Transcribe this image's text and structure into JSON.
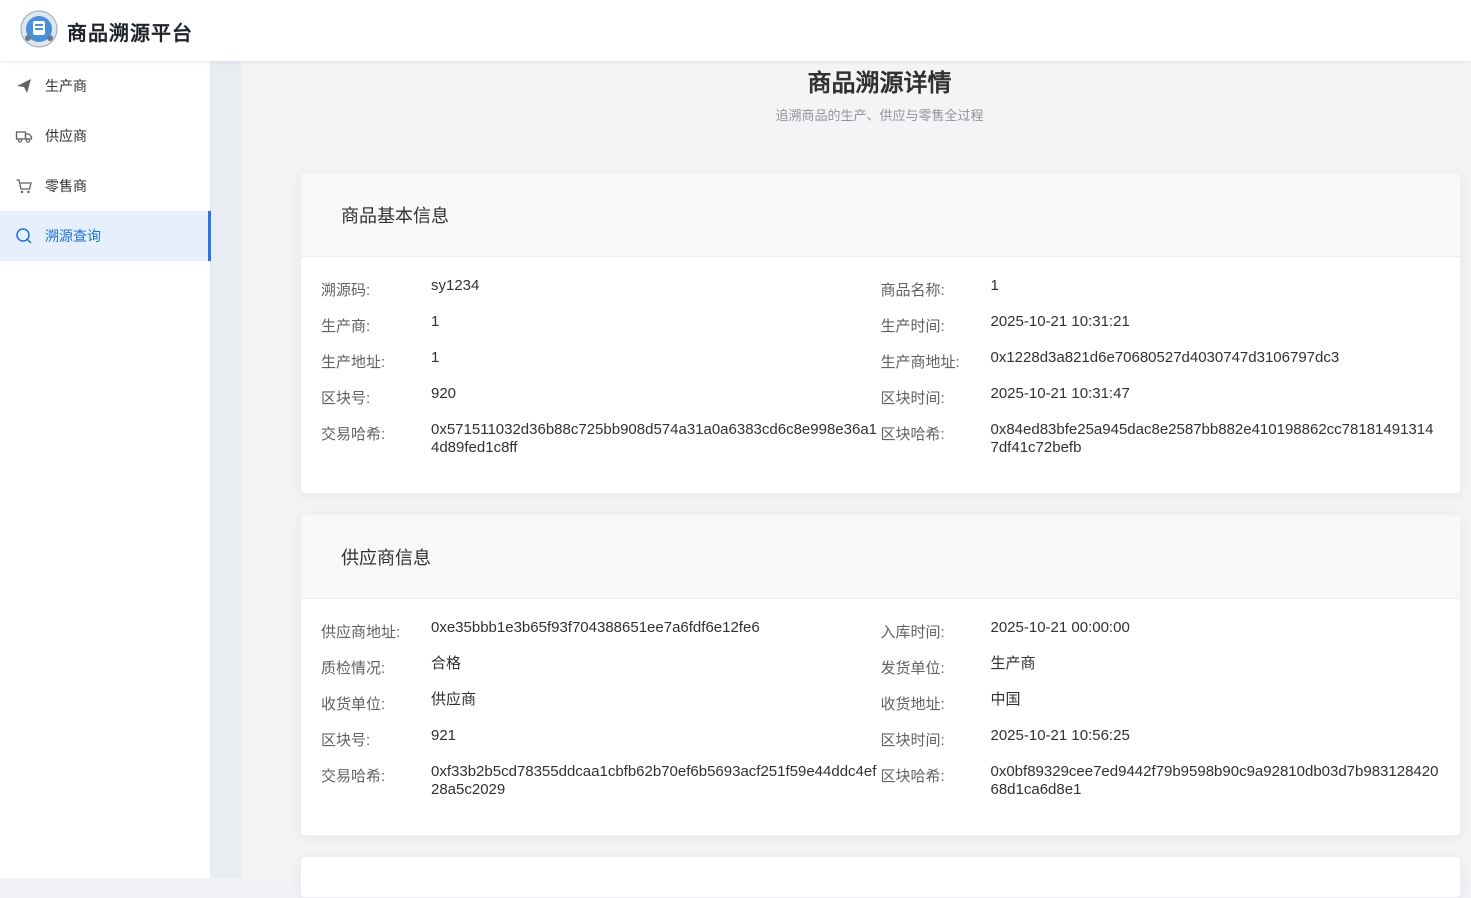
{
  "app": {
    "title": "商品溯源平台"
  },
  "sidebar": {
    "items": [
      {
        "label": "生产商",
        "icon": "paper-plane-icon"
      },
      {
        "label": "供应商",
        "icon": "truck-icon"
      },
      {
        "label": "零售商",
        "icon": "cart-icon"
      },
      {
        "label": "溯源查询",
        "icon": "search-icon"
      }
    ]
  },
  "page": {
    "title": "商品溯源详情",
    "subtitle": "追溯商品的生产、供应与零售全过程"
  },
  "basic_info": {
    "heading": "商品基本信息",
    "rows": [
      [
        {
          "label": "溯源码:",
          "value": "sy1234"
        },
        {
          "label": "商品名称:",
          "value": "1"
        }
      ],
      [
        {
          "label": "生产商:",
          "value": "1"
        },
        {
          "label": "生产时间:",
          "value": "2025-10-21 10:31:21"
        }
      ],
      [
        {
          "label": "生产地址:",
          "value": "1"
        },
        {
          "label": "生产商地址:",
          "value": "0x1228d3a821d6e70680527d4030747d3106797dc3"
        }
      ],
      [
        {
          "label": "区块号:",
          "value": "920"
        },
        {
          "label": "区块时间:",
          "value": "2025-10-21 10:31:47"
        }
      ],
      [
        {
          "label": "交易哈希:",
          "value": "0x571511032d36b88c725bb908d574a31a0a6383cd6c8e998e36a14d89fed1c8ff"
        },
        {
          "label": "区块哈希:",
          "value": "0x84ed83bfe25a945dac8e2587bb882e410198862cc781814913147df41c72befb"
        }
      ]
    ]
  },
  "supplier_info": {
    "heading": "供应商信息",
    "rows": [
      [
        {
          "label": "供应商地址:",
          "value": "0xe35bbb1e3b65f93f704388651ee7a6fdf6e12fe6"
        },
        {
          "label": "入库时间:",
          "value": "2025-10-21 00:00:00"
        }
      ],
      [
        {
          "label": "质检情况:",
          "value": "合格"
        },
        {
          "label": "发货单位:",
          "value": "生产商"
        }
      ],
      [
        {
          "label": "收货单位:",
          "value": "供应商"
        },
        {
          "label": "收货地址:",
          "value": "中国"
        }
      ],
      [
        {
          "label": "区块号:",
          "value": "921"
        },
        {
          "label": "区块时间:",
          "value": "2025-10-21 10:56:25"
        }
      ],
      [
        {
          "label": "交易哈希:",
          "value": "0xf33b2b5cd78355ddcaa1cbfb62b70ef6b5693acf251f59e44ddc4ef28a5c2029"
        },
        {
          "label": "区块哈希:",
          "value": "0x0bf89329cee7ed9442f79b9598b90c9a92810db03d7b98312842068d1ca6d8e1"
        }
      ]
    ]
  },
  "colors": {
    "accent": "#2a79e0",
    "active_bg": "#e6f0fc"
  }
}
